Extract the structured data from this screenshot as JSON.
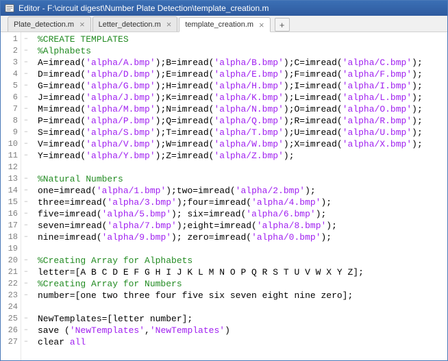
{
  "window": {
    "title": "Editor - F:\\circuit digest\\Number Plate Detection\\template_creation.m"
  },
  "tabs": [
    {
      "label": "Plate_detection.m",
      "active": false
    },
    {
      "label": "Letter_detection.m",
      "active": false
    },
    {
      "label": "template_creation.m",
      "active": true
    }
  ],
  "code": {
    "lines": [
      {
        "n": 1,
        "tokens": [
          {
            "t": "%CREATE TEMPLATES",
            "c": "comment"
          }
        ]
      },
      {
        "n": 2,
        "tokens": [
          {
            "t": "%Alphabets",
            "c": "comment"
          }
        ]
      },
      {
        "n": 3,
        "tokens": [
          {
            "t": "A=imread(",
            "c": "text"
          },
          {
            "t": "'alpha/A.bmp'",
            "c": "string"
          },
          {
            "t": ");B=imread(",
            "c": "text"
          },
          {
            "t": "'alpha/B.bmp'",
            "c": "string"
          },
          {
            "t": ");C=imread(",
            "c": "text"
          },
          {
            "t": "'alpha/C.bmp'",
            "c": "string"
          },
          {
            "t": ");",
            "c": "text"
          }
        ]
      },
      {
        "n": 4,
        "tokens": [
          {
            "t": "D=imread(",
            "c": "text"
          },
          {
            "t": "'alpha/D.bmp'",
            "c": "string"
          },
          {
            "t": ");E=imread(",
            "c": "text"
          },
          {
            "t": "'alpha/E.bmp'",
            "c": "string"
          },
          {
            "t": ");F=imread(",
            "c": "text"
          },
          {
            "t": "'alpha/F.bmp'",
            "c": "string"
          },
          {
            "t": ");",
            "c": "text"
          }
        ]
      },
      {
        "n": 5,
        "tokens": [
          {
            "t": "G=imread(",
            "c": "text"
          },
          {
            "t": "'alpha/G.bmp'",
            "c": "string"
          },
          {
            "t": ");H=imread(",
            "c": "text"
          },
          {
            "t": "'alpha/H.bmp'",
            "c": "string"
          },
          {
            "t": ");I=imread(",
            "c": "text"
          },
          {
            "t": "'alpha/I.bmp'",
            "c": "string"
          },
          {
            "t": ");",
            "c": "text"
          }
        ]
      },
      {
        "n": 6,
        "tokens": [
          {
            "t": "J=imread(",
            "c": "text"
          },
          {
            "t": "'alpha/J.bmp'",
            "c": "string"
          },
          {
            "t": ");K=imread(",
            "c": "text"
          },
          {
            "t": "'alpha/K.bmp'",
            "c": "string"
          },
          {
            "t": ");L=imread(",
            "c": "text"
          },
          {
            "t": "'alpha/L.bmp'",
            "c": "string"
          },
          {
            "t": ");",
            "c": "text"
          }
        ]
      },
      {
        "n": 7,
        "tokens": [
          {
            "t": "M=imread(",
            "c": "text"
          },
          {
            "t": "'alpha/M.bmp'",
            "c": "string"
          },
          {
            "t": ");N=imread(",
            "c": "text"
          },
          {
            "t": "'alpha/N.bmp'",
            "c": "string"
          },
          {
            "t": ");O=imread(",
            "c": "text"
          },
          {
            "t": "'alpha/O.bmp'",
            "c": "string"
          },
          {
            "t": ");",
            "c": "text"
          }
        ]
      },
      {
        "n": 8,
        "tokens": [
          {
            "t": "P=imread(",
            "c": "text"
          },
          {
            "t": "'alpha/P.bmp'",
            "c": "string"
          },
          {
            "t": ");Q=imread(",
            "c": "text"
          },
          {
            "t": "'alpha/Q.bmp'",
            "c": "string"
          },
          {
            "t": ");R=imread(",
            "c": "text"
          },
          {
            "t": "'alpha/R.bmp'",
            "c": "string"
          },
          {
            "t": ");",
            "c": "text"
          }
        ]
      },
      {
        "n": 9,
        "tokens": [
          {
            "t": "S=imread(",
            "c": "text"
          },
          {
            "t": "'alpha/S.bmp'",
            "c": "string"
          },
          {
            "t": ");T=imread(",
            "c": "text"
          },
          {
            "t": "'alpha/T.bmp'",
            "c": "string"
          },
          {
            "t": ");U=imread(",
            "c": "text"
          },
          {
            "t": "'alpha/U.bmp'",
            "c": "string"
          },
          {
            "t": ");",
            "c": "text"
          }
        ]
      },
      {
        "n": 10,
        "tokens": [
          {
            "t": "V=imread(",
            "c": "text"
          },
          {
            "t": "'alpha/V.bmp'",
            "c": "string"
          },
          {
            "t": ");W=imread(",
            "c": "text"
          },
          {
            "t": "'alpha/W.bmp'",
            "c": "string"
          },
          {
            "t": ");X=imread(",
            "c": "text"
          },
          {
            "t": "'alpha/X.bmp'",
            "c": "string"
          },
          {
            "t": ");",
            "c": "text"
          }
        ]
      },
      {
        "n": 11,
        "tokens": [
          {
            "t": "Y=imread(",
            "c": "text"
          },
          {
            "t": "'alpha/Y.bmp'",
            "c": "string"
          },
          {
            "t": ");Z=imread(",
            "c": "text"
          },
          {
            "t": "'alpha/Z.bmp'",
            "c": "string"
          },
          {
            "t": ");",
            "c": "text"
          }
        ]
      },
      {
        "n": 12,
        "tokens": []
      },
      {
        "n": 13,
        "tokens": [
          {
            "t": "%Natural Numbers",
            "c": "comment"
          }
        ]
      },
      {
        "n": 14,
        "tokens": [
          {
            "t": "one=imread(",
            "c": "text"
          },
          {
            "t": "'alpha/1.bmp'",
            "c": "string"
          },
          {
            "t": ");two=imread(",
            "c": "text"
          },
          {
            "t": "'alpha/2.bmp'",
            "c": "string"
          },
          {
            "t": ");",
            "c": "text"
          }
        ]
      },
      {
        "n": 15,
        "tokens": [
          {
            "t": "three=imread(",
            "c": "text"
          },
          {
            "t": "'alpha/3.bmp'",
            "c": "string"
          },
          {
            "t": ");four=imread(",
            "c": "text"
          },
          {
            "t": "'alpha/4.bmp'",
            "c": "string"
          },
          {
            "t": ");",
            "c": "text"
          }
        ]
      },
      {
        "n": 16,
        "tokens": [
          {
            "t": "five=imread(",
            "c": "text"
          },
          {
            "t": "'alpha/5.bmp'",
            "c": "string"
          },
          {
            "t": "); six=imread(",
            "c": "text"
          },
          {
            "t": "'alpha/6.bmp'",
            "c": "string"
          },
          {
            "t": ");",
            "c": "text"
          }
        ]
      },
      {
        "n": 17,
        "tokens": [
          {
            "t": "seven=imread(",
            "c": "text"
          },
          {
            "t": "'alpha/7.bmp'",
            "c": "string"
          },
          {
            "t": ");eight=imread(",
            "c": "text"
          },
          {
            "t": "'alpha/8.bmp'",
            "c": "string"
          },
          {
            "t": ");",
            "c": "text"
          }
        ]
      },
      {
        "n": 18,
        "tokens": [
          {
            "t": "nine=imread(",
            "c": "text"
          },
          {
            "t": "'alpha/9.bmp'",
            "c": "string"
          },
          {
            "t": "); zero=imread(",
            "c": "text"
          },
          {
            "t": "'alpha/0.bmp'",
            "c": "string"
          },
          {
            "t": ");",
            "c": "text"
          }
        ]
      },
      {
        "n": 19,
        "tokens": []
      },
      {
        "n": 20,
        "tokens": [
          {
            "t": "%Creating Array for Alphabets",
            "c": "comment"
          }
        ]
      },
      {
        "n": 21,
        "tokens": [
          {
            "t": "letter=[A B C D E F G H I J K L M N O P Q R S T U V W X Y Z];",
            "c": "text"
          }
        ]
      },
      {
        "n": 22,
        "tokens": [
          {
            "t": "%Creating Array for Numbers",
            "c": "comment"
          }
        ]
      },
      {
        "n": 23,
        "tokens": [
          {
            "t": "number=[one two three four five six seven eight nine zero];",
            "c": "text"
          }
        ]
      },
      {
        "n": 24,
        "tokens": []
      },
      {
        "n": 25,
        "tokens": [
          {
            "t": "NewTemplates=[letter number];",
            "c": "text"
          }
        ]
      },
      {
        "n": 26,
        "tokens": [
          {
            "t": "save (",
            "c": "text"
          },
          {
            "t": "'NewTemplates'",
            "c": "string"
          },
          {
            "t": ",",
            "c": "text"
          },
          {
            "t": "'NewTemplates'",
            "c": "string"
          },
          {
            "t": ")",
            "c": "text"
          }
        ]
      },
      {
        "n": 27,
        "tokens": [
          {
            "t": "clear ",
            "c": "text"
          },
          {
            "t": "all",
            "c": "string"
          }
        ]
      }
    ]
  }
}
